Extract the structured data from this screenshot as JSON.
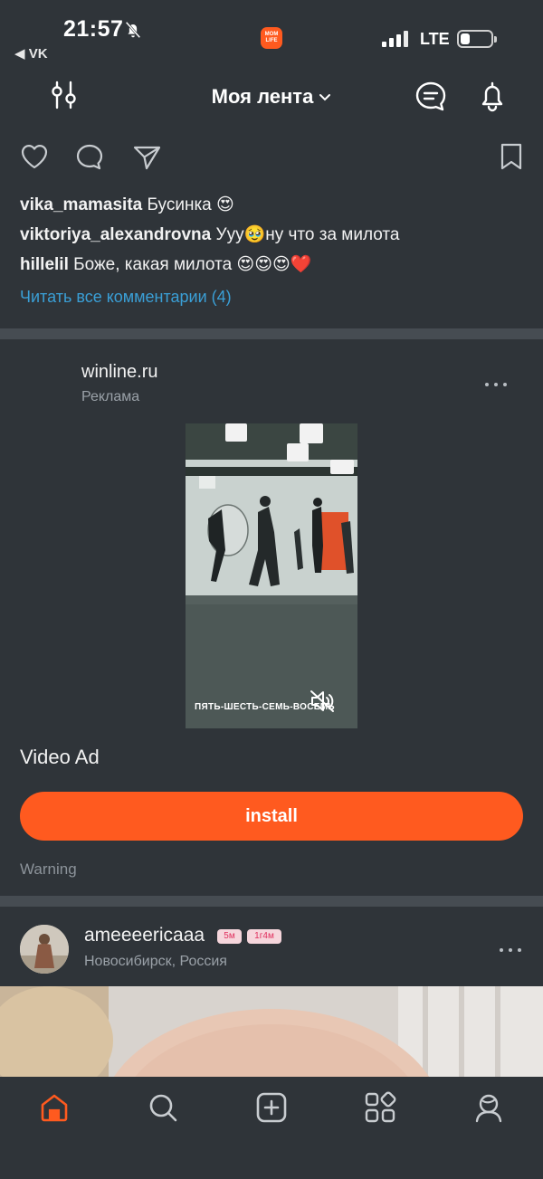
{
  "status_bar": {
    "time": "21:57",
    "back_app": "◀ VK",
    "app_badge": "MOM LIFE",
    "network": "LTE",
    "battery_level": 0.3
  },
  "header": {
    "title": "Моя лента"
  },
  "comments": [
    {
      "user": "vika_mamasita",
      "text": "Бусинка 😍"
    },
    {
      "user": "viktoriya_alexandrovna",
      "text": "Ууу🥹ну что за милота"
    },
    {
      "user": "hillelil",
      "text": "Боже, какая милота 😍😍😍❤️"
    }
  ],
  "read_all_comments": "Читать все комментарии (4)",
  "ad": {
    "advertiser": "winline.ru",
    "label": "Реклама",
    "video_caption": "ПЯТЬ-ШЕСТЬ-СЕМЬ-ВОСЕМЬ",
    "title": "Video Ad",
    "install_label": "install",
    "warning": "Warning"
  },
  "next_post": {
    "user": "ameeeericaaa",
    "badge_1": "5м",
    "badge_2": "1г4м",
    "location": "Новосибирск, Россия"
  },
  "colors": {
    "background": "#2f3439",
    "accent": "#ff5a1f",
    "link": "#3a9fd6",
    "divider": "#464c52"
  },
  "icons": {
    "status": [
      "bell-off-icon",
      "signal-icon",
      "battery-icon"
    ],
    "header": [
      "filter-icon",
      "chevron-down-icon",
      "chat-icon",
      "bell-icon"
    ],
    "post_actions": [
      "heart-icon",
      "comment-icon",
      "share-icon",
      "bookmark-icon"
    ],
    "bottom_nav": [
      "home-icon",
      "search-icon",
      "add-icon",
      "apps-icon",
      "profile-icon"
    ]
  }
}
